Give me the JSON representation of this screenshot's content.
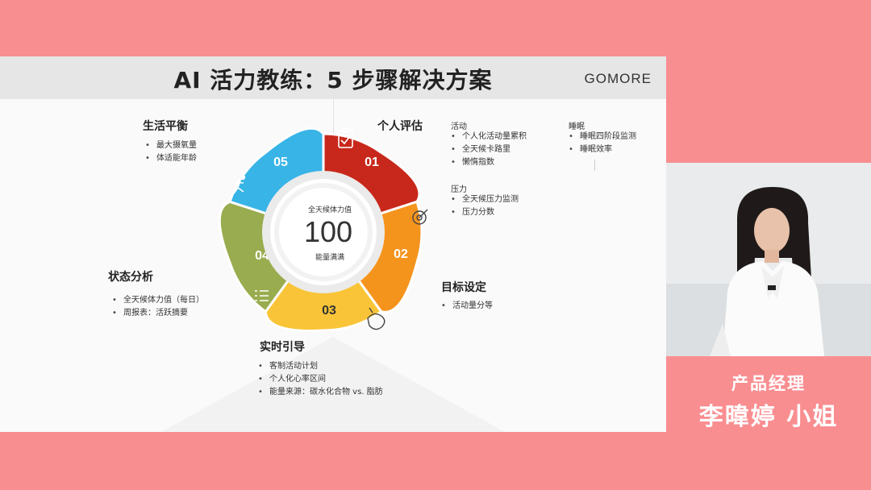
{
  "slide": {
    "title": "AI 活力教练：5 步骤解决方案",
    "logo": "GOMORE",
    "center": {
      "label": "全天候体力值",
      "value": "100",
      "caption": "能量满满"
    },
    "petals": [
      {
        "number": "01",
        "color": "#c8281b",
        "icon": "clipboard-icon"
      },
      {
        "number": "02",
        "color": "#f5941d",
        "icon": "target-icon"
      },
      {
        "number": "03",
        "color": "#f9c437",
        "icon": "whistle-icon"
      },
      {
        "number": "04",
        "color": "#99ac4f",
        "icon": "checklist-icon"
      },
      {
        "number": "05",
        "color": "#38b4e7",
        "icon": "runner-icon"
      }
    ],
    "sections": {
      "life_balance": {
        "title": "生活平衡",
        "items": [
          "最大摄氧量",
          "体适能年龄"
        ]
      },
      "personal_eval": {
        "title": "个人评估",
        "activity": {
          "heading": "活动",
          "items": [
            "个人化活动量累积",
            "全天候卡路里",
            "懒惰指数"
          ]
        },
        "pressure": {
          "heading": "压力",
          "items": [
            "全天候压力监测",
            "压力分数"
          ]
        },
        "sleep": {
          "heading": "睡眠",
          "items": [
            "睡眠四阶段监测",
            "睡眠效率"
          ]
        }
      },
      "goal_setting": {
        "title": "目标设定",
        "items": [
          "活动量分等"
        ]
      },
      "realtime_guidance": {
        "title": "实时引导",
        "items": [
          "客制活动计划",
          "个人化心率区间",
          "能量来源：碳水化合物 vs. 脂肪"
        ]
      },
      "status_analysis": {
        "title": "状态分析",
        "items": [
          "全天候体力值（每日）",
          "周报表：活跃摘要"
        ]
      }
    }
  },
  "speaker": {
    "role": "产品经理",
    "name": "李暐婷 小姐"
  }
}
